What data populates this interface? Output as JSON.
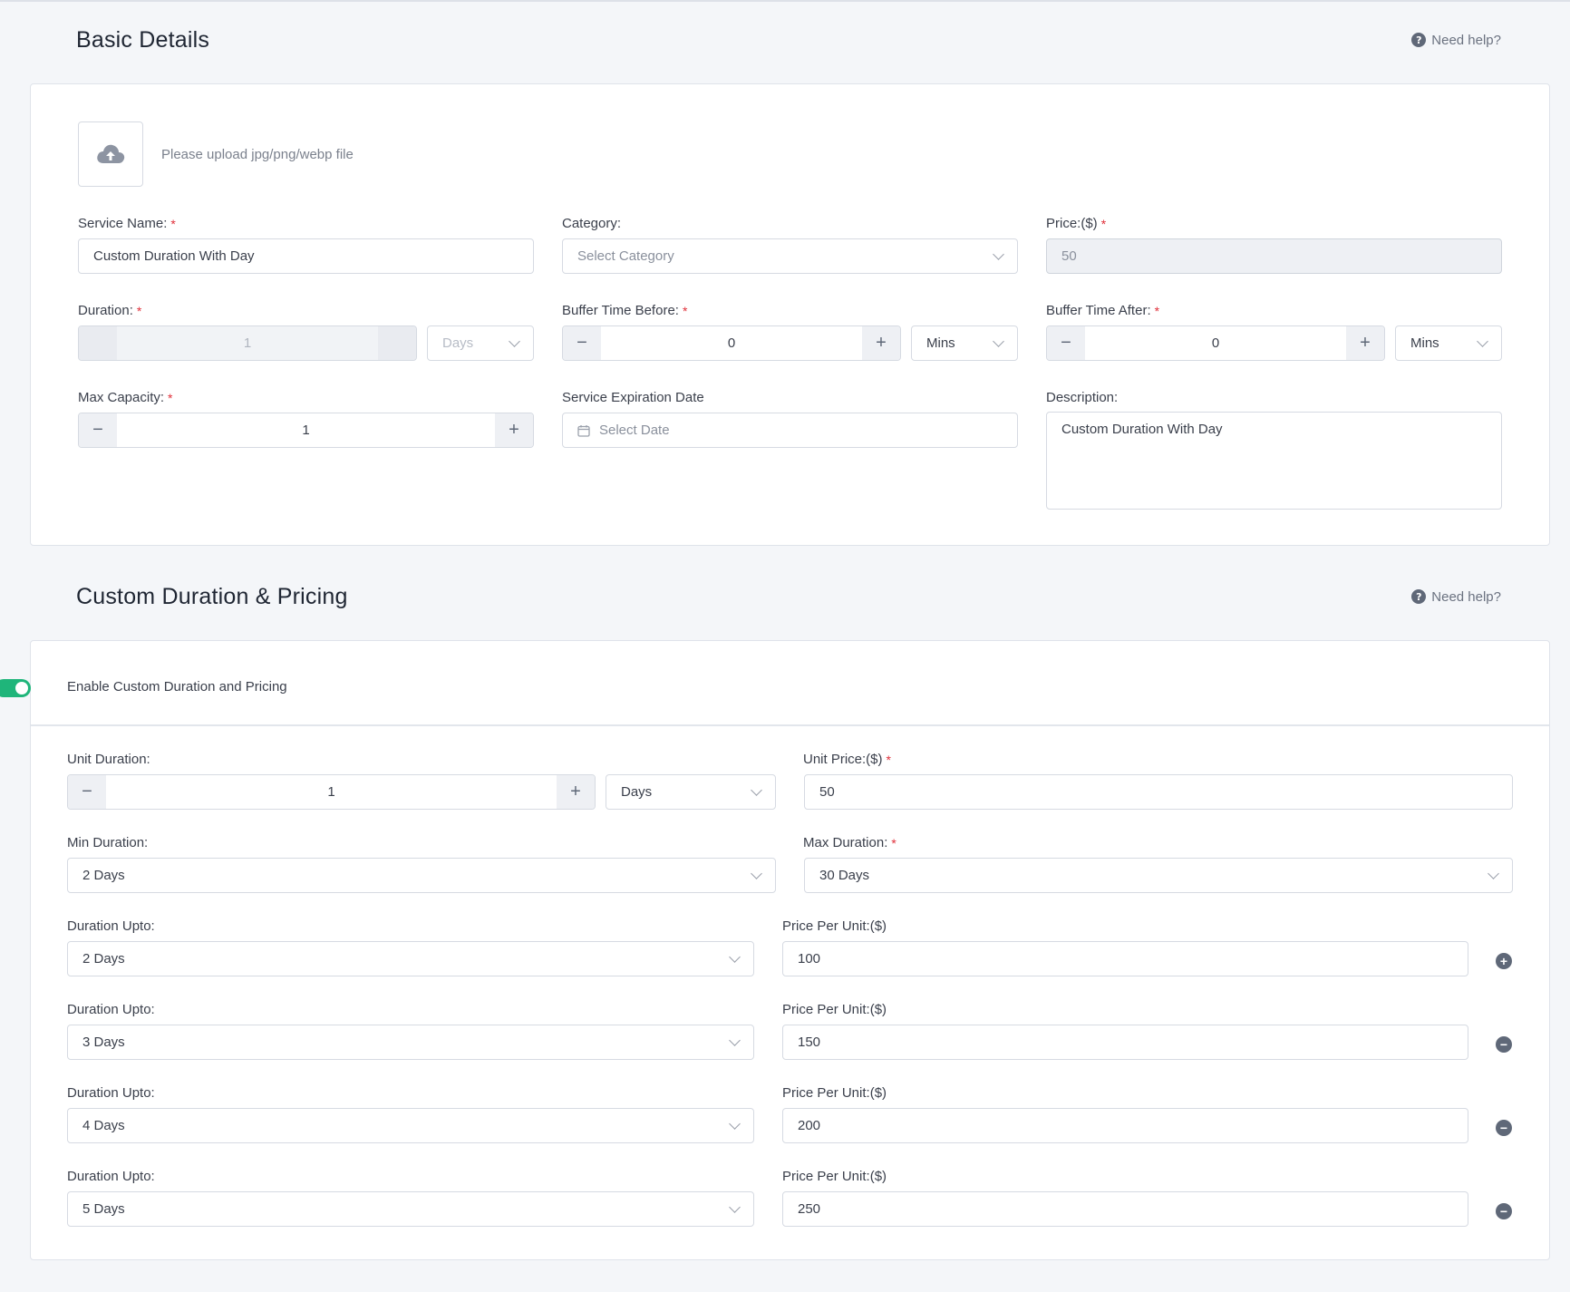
{
  "help_text": "Need help?",
  "basic": {
    "title": "Basic Details",
    "upload_hint": "Please upload jpg/png/webp file",
    "service_name": {
      "label": "Service Name:",
      "value": "Custom Duration With Day"
    },
    "category": {
      "label": "Category:",
      "placeholder": "Select Category"
    },
    "price": {
      "label": "Price:($)",
      "value": "50"
    },
    "duration": {
      "label": "Duration:",
      "value": "1",
      "unit": "Days"
    },
    "buffer_before": {
      "label": "Buffer Time Before:",
      "value": "0",
      "unit": "Mins"
    },
    "buffer_after": {
      "label": "Buffer Time After:",
      "value": "0",
      "unit": "Mins"
    },
    "max_capacity": {
      "label": "Max Capacity:",
      "value": "1"
    },
    "expiration": {
      "label": "Service Expiration Date",
      "placeholder": "Select Date"
    },
    "description": {
      "label": "Description:",
      "value": "Custom Duration With Day"
    }
  },
  "custom": {
    "title": "Custom Duration & Pricing",
    "enable_label": "Enable Custom Duration and Pricing",
    "enabled": true,
    "unit_duration": {
      "label": "Unit Duration:",
      "value": "1",
      "unit": "Days"
    },
    "unit_price": {
      "label": "Unit Price:($)",
      "value": "50"
    },
    "min_duration": {
      "label": "Min Duration:",
      "value": "2 Days"
    },
    "max_duration": {
      "label": "Max Duration:",
      "value": "30 Days"
    },
    "tier_labels": {
      "duration": "Duration Upto:",
      "price": "Price Per Unit:($)"
    },
    "tiers": [
      {
        "duration": "2 Days",
        "price": "100",
        "action": "add"
      },
      {
        "duration": "3 Days",
        "price": "150",
        "action": "remove"
      },
      {
        "duration": "4 Days",
        "price": "200",
        "action": "remove"
      },
      {
        "duration": "5 Days",
        "price": "250",
        "action": "remove"
      }
    ]
  },
  "colors": {
    "toggle_on": "#1fb57a",
    "required": "#e0303a"
  }
}
